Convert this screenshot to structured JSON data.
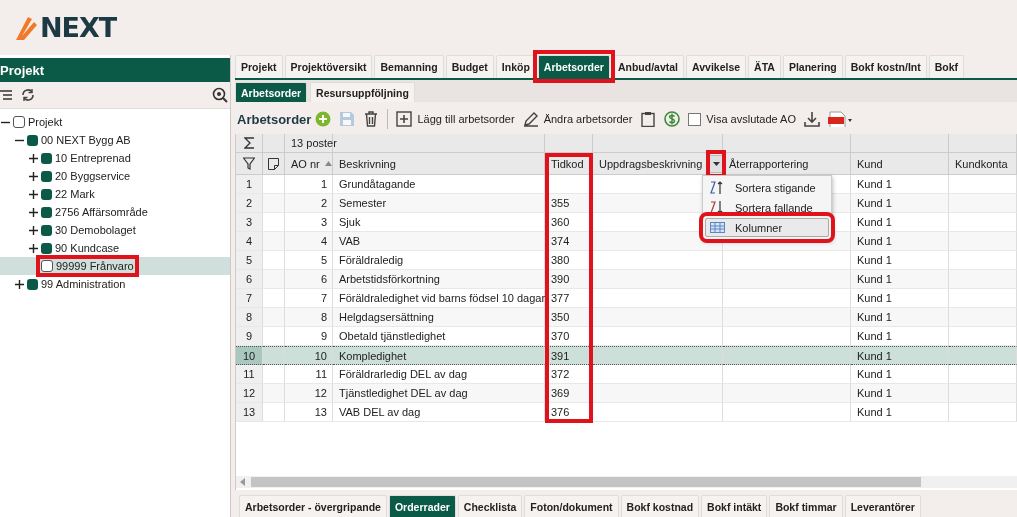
{
  "logo": {
    "text": "NEXT"
  },
  "sidebar": {
    "title": "Projekt",
    "tree": [
      {
        "label": "Projekt",
        "kind": "checkbox",
        "expanded": true,
        "selected": false,
        "children": [
          {
            "label": "00 NEXT Bygg AB",
            "kind": "folder",
            "expanded": true,
            "selected": false,
            "children": [
              {
                "label": "10 Entreprenad",
                "kind": "folder",
                "expanded": false,
                "selected": false
              },
              {
                "label": "20 Byggservice",
                "kind": "folder",
                "expanded": false,
                "selected": false
              },
              {
                "label": "22 Mark",
                "kind": "folder",
                "expanded": false,
                "selected": false
              },
              {
                "label": "2756 Affärsområde",
                "kind": "folder",
                "expanded": false,
                "selected": false
              },
              {
                "label": "30 Demobolaget",
                "kind": "folder",
                "expanded": false,
                "selected": false
              },
              {
                "label": "90 Kundcase",
                "kind": "folder",
                "expanded": false,
                "selected": false
              },
              {
                "label": "99999 Frånvaro",
                "kind": "checkbox",
                "selected": true,
                "highlighted": true
              }
            ]
          },
          {
            "label": "99 Administration",
            "kind": "folder",
            "expanded": false,
            "selected": false
          }
        ]
      }
    ]
  },
  "tabs": [
    {
      "label": "Projekt",
      "selected": false
    },
    {
      "label": "Projektöversikt",
      "selected": false
    },
    {
      "label": "Bemanning",
      "selected": false
    },
    {
      "label": "Budget",
      "selected": false
    },
    {
      "label": "Inköp",
      "selected": false
    },
    {
      "label": "Arbetsorder",
      "selected": true,
      "highlighted": true
    },
    {
      "label": "Anbud/avtal",
      "selected": false
    },
    {
      "label": "Avvikelse",
      "selected": false
    },
    {
      "label": "ÄTA",
      "selected": false
    },
    {
      "label": "Planering",
      "selected": false
    },
    {
      "label": "Bokf kostn/Int",
      "selected": false
    },
    {
      "label": "Bokf",
      "selected": false
    }
  ],
  "subtabs": [
    {
      "label": "Arbetsorder",
      "selected": true
    },
    {
      "label": "Resursuppföljning",
      "selected": false
    }
  ],
  "toolbar": {
    "title": "Arbetsorder",
    "items": [
      {
        "kind": "add"
      },
      {
        "kind": "save",
        "disabled": true
      },
      {
        "kind": "delete"
      },
      {
        "kind": "separator"
      },
      {
        "kind": "new",
        "label": "Lägg till arbetsorder"
      },
      {
        "kind": "edit",
        "label": "Ändra arbetsorder"
      },
      {
        "kind": "clipboard"
      },
      {
        "kind": "currency"
      },
      {
        "kind": "checkbox",
        "label": "Visa avslutade AO",
        "checked": false
      },
      {
        "kind": "download"
      },
      {
        "kind": "pdf"
      }
    ]
  },
  "grid": {
    "summary": "13 poster",
    "columns": [
      {
        "label": "AO nr",
        "sorted_ascending": true
      },
      {
        "label": "Beskrivning"
      },
      {
        "label": "Tidkod",
        "highlighted": true
      },
      {
        "label": "Uppdragsbeskrivning",
        "menu_open": true,
        "highlighted": true
      },
      {
        "label": "Återrapportering"
      },
      {
        "label": "Kund"
      },
      {
        "label": "Kundkonta"
      }
    ],
    "rows": [
      {
        "row_number": "1",
        "ao_nr": "1",
        "beskrivning": "Grundåtagande",
        "kund": "Kund 1",
        "selected": false
      },
      {
        "row_number": "2",
        "ao_nr": "2",
        "beskrivning": "Semester",
        "tidkod": "355",
        "kund": "Kund 1",
        "selected": false
      },
      {
        "row_number": "3",
        "ao_nr": "3",
        "beskrivning": "Sjuk",
        "tidkod": "360",
        "kund": "Kund 1",
        "selected": false
      },
      {
        "row_number": "4",
        "ao_nr": "4",
        "beskrivning": "VAB",
        "tidkod": "374",
        "kund": "Kund 1",
        "selected": false
      },
      {
        "row_number": "5",
        "ao_nr": "5",
        "beskrivning": "Föräldraledig",
        "tidkod": "380",
        "kund": "Kund 1",
        "selected": false
      },
      {
        "row_number": "6",
        "ao_nr": "6",
        "beskrivning": "Arbetstidsförkortning",
        "tidkod": "390",
        "kund": "Kund 1",
        "selected": false
      },
      {
        "row_number": "7",
        "ao_nr": "7",
        "beskrivning": "Föräldraledighet vid barns födsel 10 dagar",
        "tidkod": "377",
        "kund": "Kund 1",
        "selected": false
      },
      {
        "row_number": "8",
        "ao_nr": "8",
        "beskrivning": "Helgdagsersättning",
        "tidkod": "350",
        "kund": "Kund 1",
        "selected": false
      },
      {
        "row_number": "9",
        "ao_nr": "9",
        "beskrivning": "Obetald tjänstledighet",
        "tidkod": "370",
        "kund": "Kund 1",
        "selected": false
      },
      {
        "row_number": "10",
        "ao_nr": "10",
        "beskrivning": "Kompledighet",
        "tidkod": "391",
        "kund": "Kund 1",
        "selected": true
      },
      {
        "row_number": "11",
        "ao_nr": "11",
        "beskrivning": "Föräldrarledig DEL av dag",
        "tidkod": "372",
        "kund": "Kund 1",
        "selected": false
      },
      {
        "row_number": "12",
        "ao_nr": "12",
        "beskrivning": "Tjänstledighet DEL av dag",
        "tidkod": "369",
        "kund": "Kund 1",
        "selected": false
      },
      {
        "row_number": "13",
        "ao_nr": "13",
        "beskrivning": "VAB DEL av dag",
        "tidkod": "376",
        "kund": "Kund 1",
        "selected": false
      }
    ],
    "column_menu": {
      "items": [
        {
          "kind": "sort_asc",
          "label": "Sortera stigande"
        },
        {
          "kind": "sort_desc",
          "label": "Sortera fallande"
        },
        {
          "kind": "columns",
          "label": "Kolumner",
          "highlighted": true
        }
      ]
    }
  },
  "bottom_tabs": [
    {
      "label": "Arbetsorder - övergripande",
      "selected": false
    },
    {
      "label": "Orderrader",
      "selected": true
    },
    {
      "label": "Checklista",
      "selected": false
    },
    {
      "label": "Foton/dokument",
      "selected": false
    },
    {
      "label": "Bokf kostnad",
      "selected": false
    },
    {
      "label": "Bokf intäkt",
      "selected": false
    },
    {
      "label": "Bokf timmar",
      "selected": false
    },
    {
      "label": "Leverantörer",
      "selected": false
    }
  ]
}
